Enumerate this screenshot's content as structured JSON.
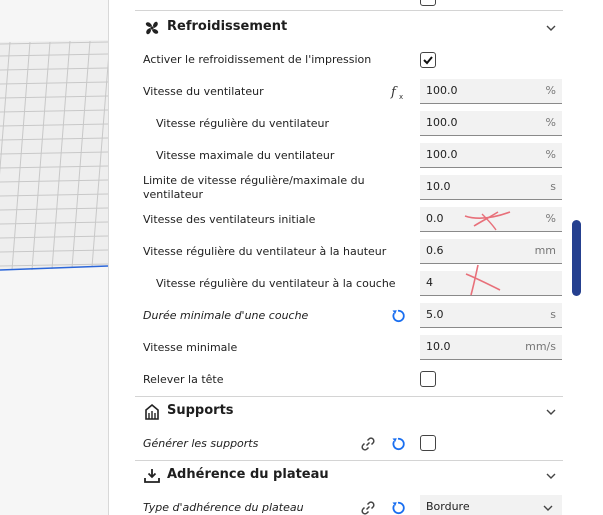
{
  "sections": {
    "cooling": {
      "title": "Refroidissement"
    },
    "supports": {
      "title": "Supports"
    },
    "adhesion": {
      "title": "Adhérence du plateau"
    }
  },
  "rows": [
    {
      "label": "Activer le refroidissement de l'impression",
      "type": "checkbox",
      "checked": true
    },
    {
      "label": "Vitesse du ventilateur",
      "value": "100.0",
      "unit": "%",
      "icon": "function-icon"
    },
    {
      "label": "Vitesse régulière du ventilateur",
      "value": "100.0",
      "unit": "%"
    },
    {
      "label": "Vitesse maximale du ventilateur",
      "value": "100.0",
      "unit": "%"
    },
    {
      "label": "Limite de vitesse régulière/maximale du ventilateur",
      "value": "10.0",
      "unit": "s"
    },
    {
      "label": "Vitesse des ventilateurs initiale",
      "value": "0.0",
      "unit": "%"
    },
    {
      "label": "Vitesse régulière du ventilateur à la hauteur",
      "value": "0.6",
      "unit": "mm"
    },
    {
      "label": "Vitesse régulière du ventilateur à la couche",
      "value": "4",
      "unit": ""
    },
    {
      "label": "Durée minimale d'une couche",
      "value": "5.0",
      "unit": "s",
      "icon": "reset-icon"
    },
    {
      "label": "Vitesse minimale",
      "value": "10.0",
      "unit": "mm/s"
    },
    {
      "label": "Relever la tête",
      "type": "checkbox",
      "checked": false
    }
  ],
  "support_row": {
    "label": "Générer les supports",
    "checked": false
  },
  "adhesion_row": {
    "label": "Type d'adhérence du plateau",
    "value": "Bordure"
  },
  "colors": {
    "accent": "#25408f",
    "reset": "#196ef0",
    "annotation": "#e8707a"
  }
}
